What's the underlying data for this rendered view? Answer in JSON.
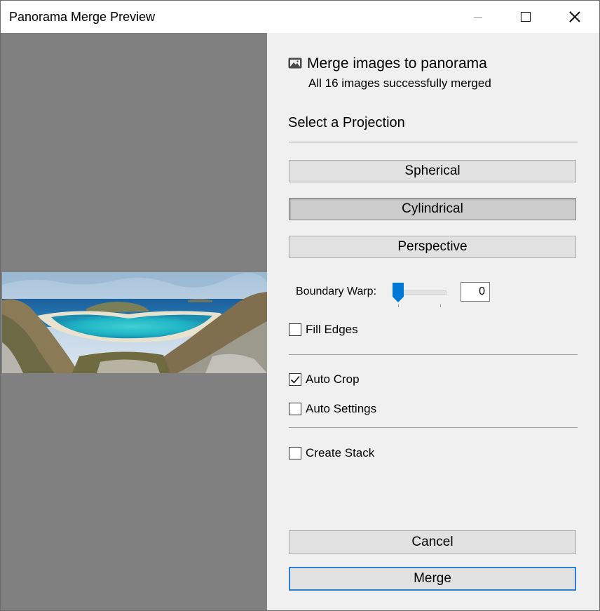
{
  "window": {
    "title": "Panorama Merge Preview",
    "controls": [
      "minimize-icon",
      "maximize-icon",
      "close-icon"
    ]
  },
  "header": {
    "icon": "image-icon",
    "title": "Merge images to panorama",
    "subtitle": "All 16 images successfully merged"
  },
  "projection": {
    "label": "Select a Projection",
    "options": [
      {
        "label": "Spherical",
        "selected": false
      },
      {
        "label": "Cylindrical",
        "selected": true
      },
      {
        "label": "Perspective",
        "selected": false
      }
    ]
  },
  "boundary_warp": {
    "label": "Boundary Warp:",
    "value": "0"
  },
  "checkboxes": {
    "fill_edges": {
      "label": "Fill Edges",
      "checked": false
    },
    "auto_crop": {
      "label": "Auto Crop",
      "checked": true
    },
    "auto_settings": {
      "label": "Auto Settings",
      "checked": false
    },
    "create_stack": {
      "label": "Create Stack",
      "checked": false
    }
  },
  "actions": {
    "cancel": "Cancel",
    "merge": "Merge"
  },
  "colors": {
    "accent": "#0078d7",
    "preview_bg": "#808080",
    "panel_bg": "#f0f0f0",
    "button_bg": "#e1e1e1"
  }
}
